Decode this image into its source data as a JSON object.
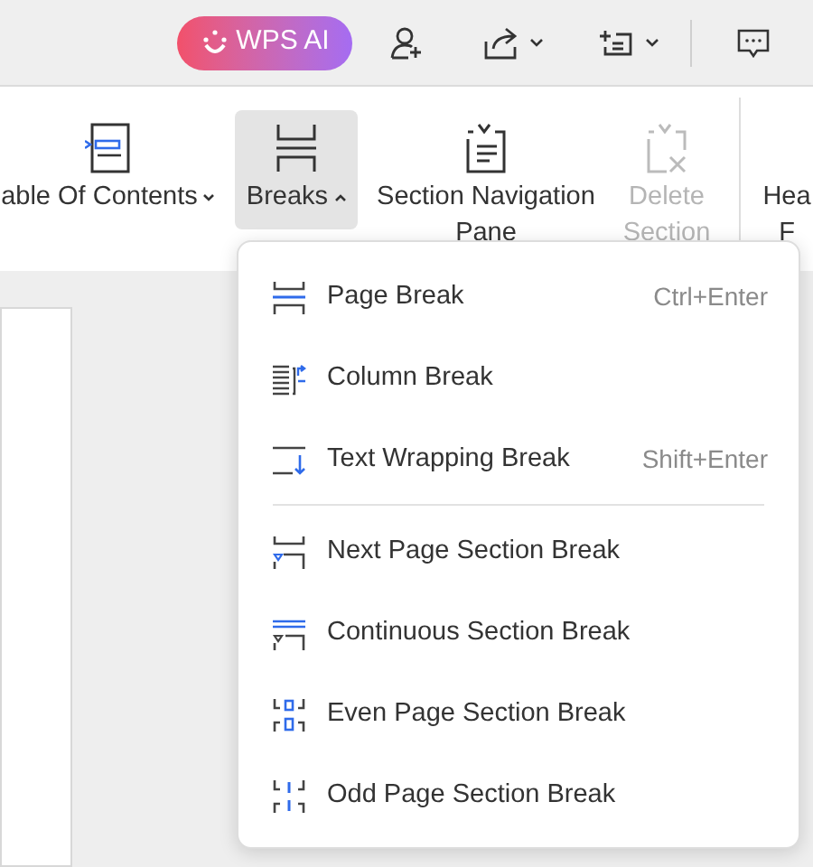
{
  "top_bar": {
    "ai_button": "WPS AI"
  },
  "ribbon": {
    "items": [
      {
        "label": "able Of Contents",
        "caret": true,
        "selected": false,
        "disabled": false
      },
      {
        "label": "Breaks",
        "caret": true,
        "selected": true,
        "disabled": false
      },
      {
        "label": "Section Navigation",
        "second_line": "Pane",
        "caret": false,
        "selected": false,
        "disabled": false
      },
      {
        "label": "Delete",
        "second_line": "Section",
        "caret": false,
        "selected": false,
        "disabled": true
      },
      {
        "label": "Hea",
        "second_line": "F",
        "caret": false,
        "selected": false,
        "disabled": false
      }
    ]
  },
  "menu": {
    "groups": [
      [
        {
          "label": "Page Break",
          "shortcut": "Ctrl+Enter"
        },
        {
          "label": "Column Break"
        },
        {
          "label": "Text Wrapping Break",
          "shortcut": "Shift+Enter"
        }
      ],
      [
        {
          "label": "Next Page Section Break"
        },
        {
          "label": "Continuous Section Break"
        },
        {
          "label": "Even Page Section Break"
        },
        {
          "label": "Odd Page Section Break"
        }
      ]
    ]
  }
}
